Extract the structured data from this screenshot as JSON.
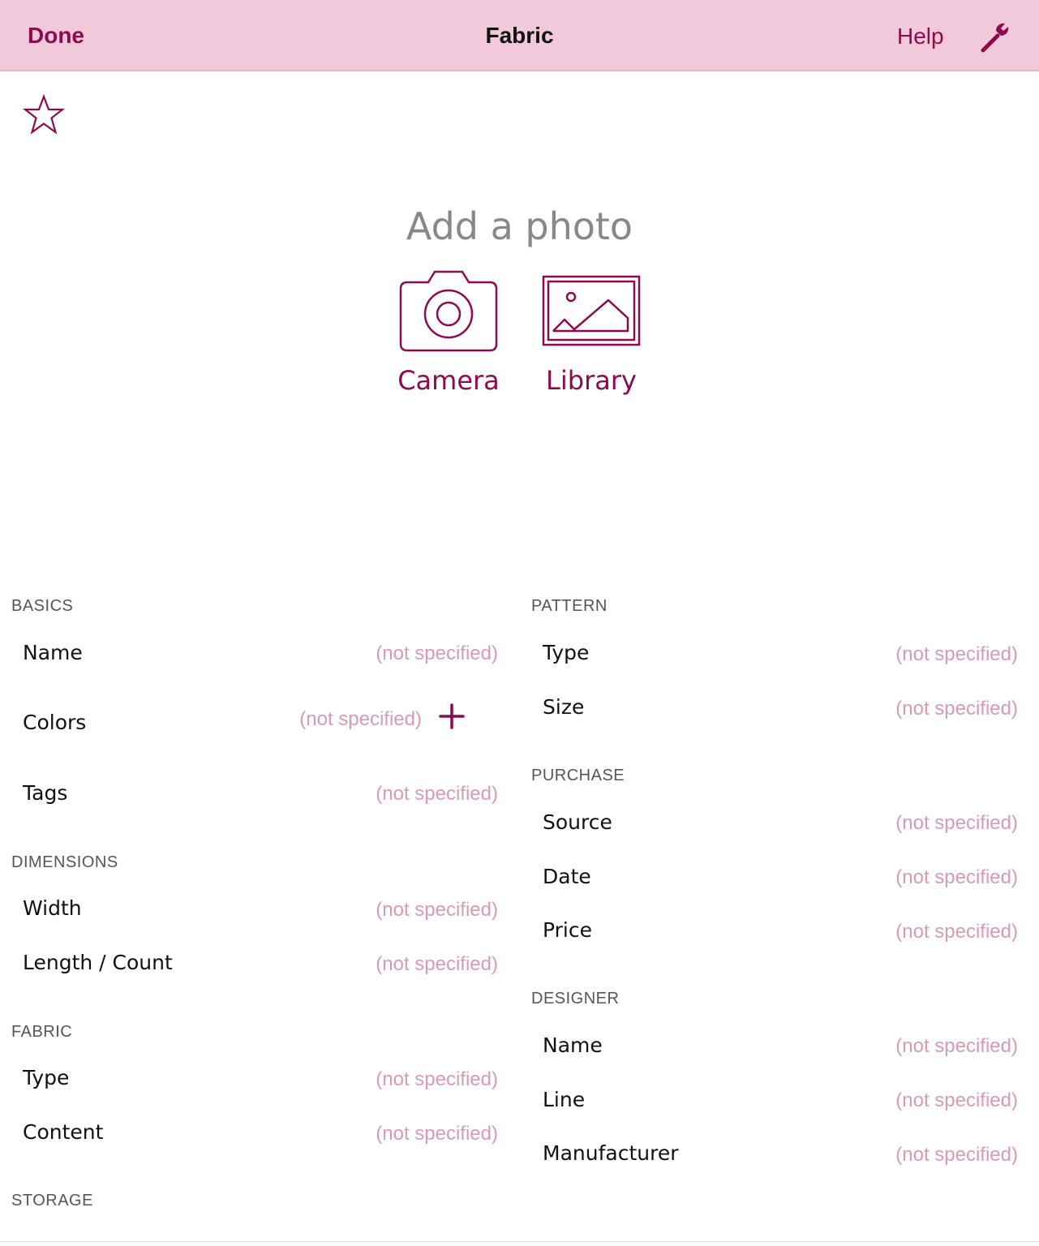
{
  "navbar": {
    "done_label": "Done",
    "title": "Fabric",
    "help_label": "Help",
    "settings_icon": "wrench-icon"
  },
  "favorite_icon": "star-outline-icon",
  "photo": {
    "heading": "Add a photo",
    "camera_label": "Camera",
    "library_label": "Library"
  },
  "placeholder": "(not specified)",
  "left_sections": [
    {
      "title": "BASICS",
      "rows": [
        "Name",
        "Colors",
        "Tags"
      ]
    },
    {
      "title": "DIMENSIONS",
      "rows": [
        "Width",
        "Length / Count"
      ]
    },
    {
      "title": "FABRIC",
      "rows": [
        "Type",
        "Content"
      ]
    },
    {
      "title": "STORAGE",
      "rows": []
    }
  ],
  "right_sections": [
    {
      "title": "PATTERN",
      "rows": [
        "Type",
        "Size"
      ]
    },
    {
      "title": "PURCHASE",
      "rows": [
        "Source",
        "Date",
        "Price"
      ]
    },
    {
      "title": "DESIGNER",
      "rows": [
        "Name",
        "Line",
        "Manufacturer"
      ]
    }
  ],
  "values": {
    "basics_name": "(not specified)",
    "basics_colors": "(not specified)",
    "basics_tags": "(not specified)",
    "dimensions_width": "(not specified)",
    "dimensions_length": "(not specified)",
    "fabric_type": "(not specified)",
    "fabric_content": "(not specified)",
    "pattern_type": "(not specified)",
    "pattern_size": "(not specified)",
    "purchase_source": "(not specified)",
    "purchase_date": "(not specified)",
    "purchase_price": "(not specified)",
    "designer_name": "(not specified)",
    "designer_line": "(not specified)",
    "designer_manufacturer": "(not specified)"
  },
  "colors": {
    "accent": "#8c0b4e",
    "navbar_bg": "#f2c9db",
    "placeholder": "#d79ab8"
  }
}
